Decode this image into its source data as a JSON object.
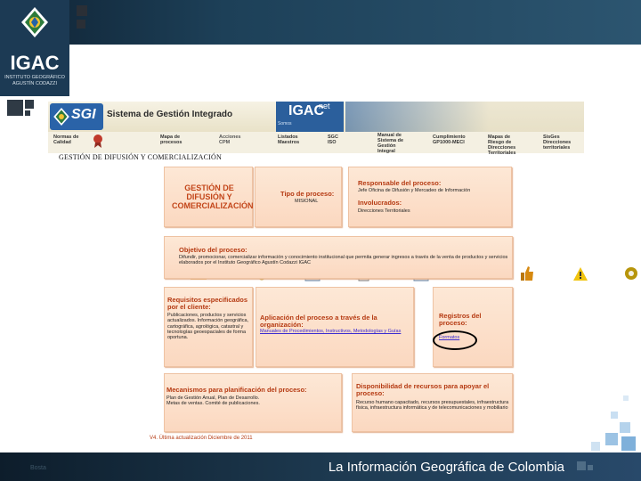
{
  "logo": {
    "text": "IGAC",
    "subtitle_line1": "INSTITUTO GEOGRÁFICO",
    "subtitle_line2": "AGUSTÍN CODAZZI"
  },
  "sgi": {
    "badge": "SGI",
    "title": "Sistema de Gestión Integrado",
    "igac_net": "IGAC",
    "igac_net_suffix": "net",
    "igac_net_sub": "Somos"
  },
  "toolbar": [
    {
      "label": "Normas de Calidad",
      "icon": "medal-icon"
    },
    {
      "label": "Mapa de procesos",
      "icon": "arrow-icon"
    },
    {
      "label": "Acciones CPM",
      "icon": "gears-icon"
    },
    {
      "label": "Listados Maestros",
      "icon": "checklist-icon"
    },
    {
      "label": "SGC ISO",
      "icon": "documents-icon"
    },
    {
      "label": "Manual de Sistema de Gestión Integral",
      "icon": "checkmark-icon"
    },
    {
      "label": "Cumplimiento GP1000-MECI",
      "icon": "thumbs-up-icon"
    },
    {
      "label": "Mapas de Riesgo de Direcciones Territoriales",
      "icon": "warning-icon"
    },
    {
      "label": "SisGes Direcciones territoriales",
      "icon": "gear-icon"
    }
  ],
  "heading": "GESTIÓN DE DIFUSIÓN Y COMERCIALIZACIÓN",
  "boxes": {
    "process_name": "GESTIÓN DE DIFUSIÓN Y COMERCIALIZACIÓN",
    "tipo_title": "Tipo de proceso:",
    "tipo_value": "MISIONAL",
    "responsable_title": "Responsable del proceso:",
    "responsable_value": "Jefe Oficina de Difusión y Mercadeo de Información",
    "involucrados_title": "Involucrados:",
    "involucrados_value": "Direcciones Territoriales",
    "objetivo_title": "Objetivo del proceso:",
    "objetivo_value": "Difundir, promocionar, comercializar información y conocimiento institucional que permita generar ingresos a través de la venta de productos y servicios elaborados por el Instituto Geográfico Agustín Codazzi IGAC",
    "requisitos_title": "Requisitos especificados por el cliente:",
    "requisitos_value": "Publicaciones, productos y servicios actualizados. Información geográfica, cartográfica, agrológica, catastral y tecnologías geoespaciales de forma oportuna.",
    "aplicacion_title": "Aplicación del proceso a través de la organización:",
    "aplicacion_link": "Manuales de Procedimientos, Instructivos, Metodologías y Guías",
    "registros_title": "Registros del proceso:",
    "registros_link": "Formatos",
    "mecanismos_title": "Mecanismos para planificación del proceso:",
    "mecanismos_value": "Plan de Gestión Anual, Plan de Desarrollo. Metas de ventas. Comité de publicaciones.",
    "disponibilidad_title": "Disponibilidad de recursos para apoyar el proceso:",
    "disponibilidad_value": "Recurso humano capacitado, recursos presupuestales, infraestructura física, infraestructura informática y de telecomunicaciones y mobiliario"
  },
  "footnote": "V4. Última actualización Diciembre de 2011",
  "footer": {
    "title": "La Información Geográfica de Colombia",
    "left": "Bosta"
  }
}
